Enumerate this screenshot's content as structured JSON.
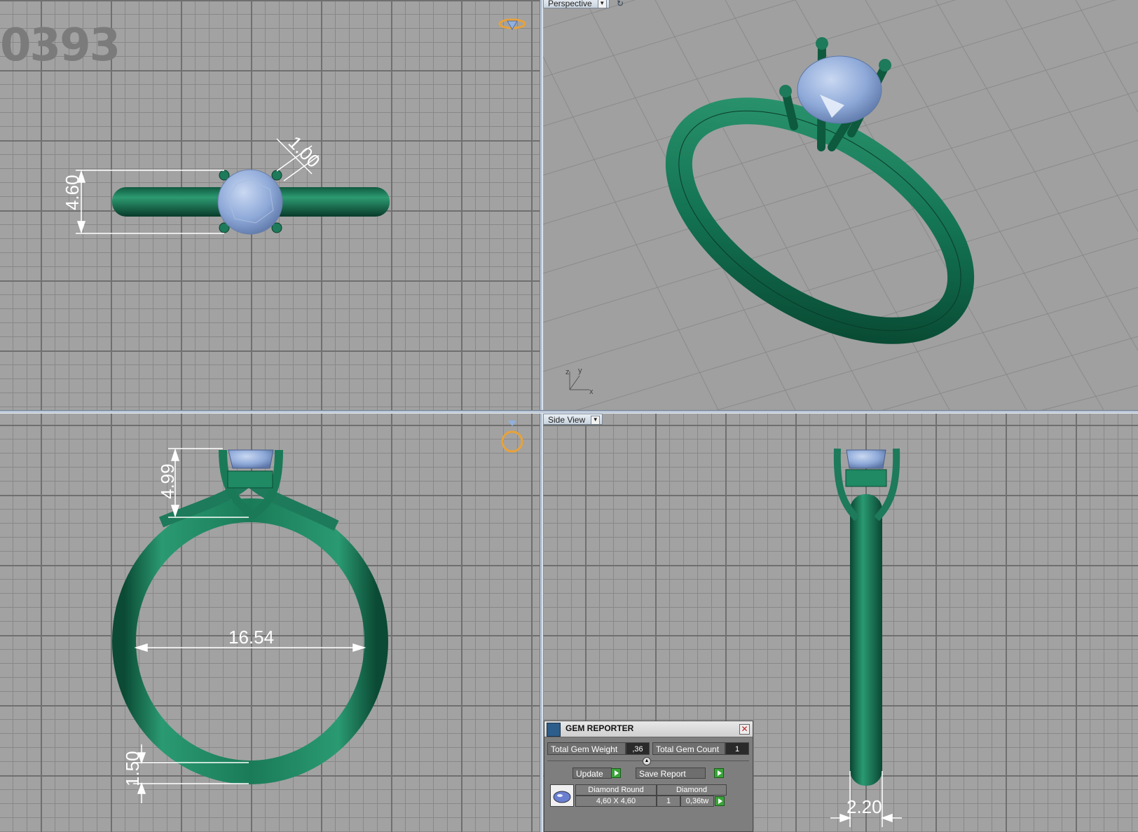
{
  "watermark": "0393",
  "viewports": {
    "perspective_label": "Perspective",
    "side_label": "Side View",
    "axes": {
      "x": "x",
      "y": "y",
      "z": "z"
    }
  },
  "dimensions": {
    "top_height": "4.60",
    "top_prong": "1.00",
    "front_setting": "4.99",
    "front_inner_diameter": "16.54",
    "front_shank": "1.50",
    "side_width": "2.20"
  },
  "gem_reporter": {
    "title": "GEM REPORTER",
    "total_weight_label": "Total Gem Weight",
    "total_weight_value": ",36",
    "total_count_label": "Total Gem Count",
    "total_count_value": "1",
    "update_label": "Update",
    "save_report_label": "Save Report",
    "table": {
      "header_shape": "Diamond Round",
      "header_material": "Diamond",
      "size": "4,60 X 4,60",
      "count": "1",
      "weight": "0,36tw"
    }
  },
  "colors": {
    "metal": "#1d7a5a",
    "gem": "#8aa6d6",
    "grid_bg": "#a2a2a2",
    "dimension": "#ffffff"
  }
}
